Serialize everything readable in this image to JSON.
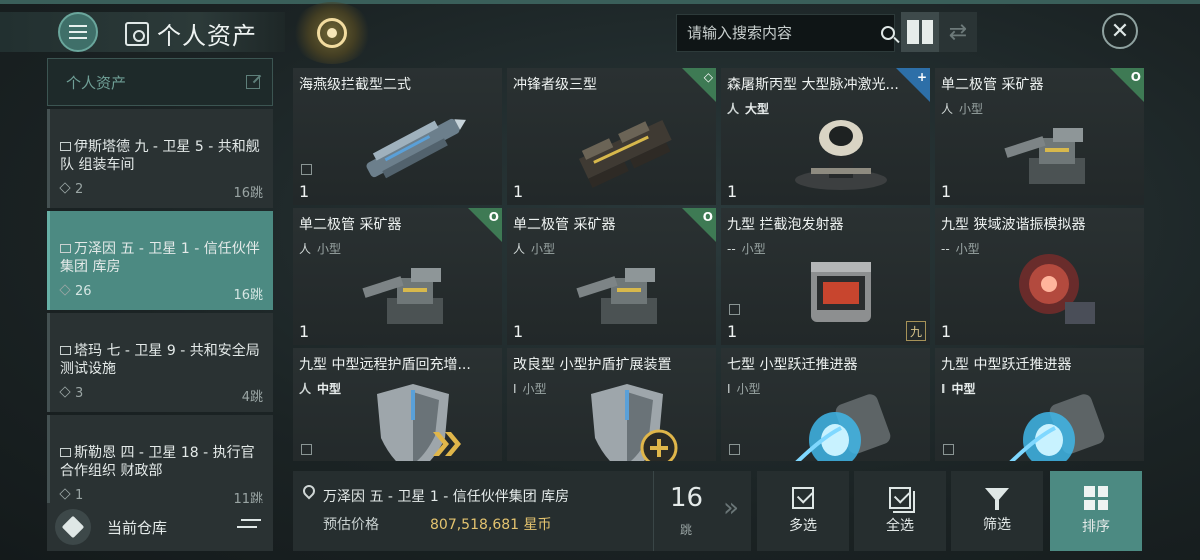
{
  "header": {
    "title": "个人资产",
    "search_placeholder": "请输入搜索内容"
  },
  "sidebar": {
    "heading": "个人资产",
    "locations": [
      {
        "name": "伊斯塔德 九 - 卫星 5 - 共和舰队 组装车间",
        "count": "2",
        "jumps": "16跳",
        "active": false
      },
      {
        "name": "万泽因 五 - 卫星 1 - 信任伙伴集团 库房",
        "count": "26",
        "jumps": "16跳",
        "active": true
      },
      {
        "name": "塔玛 七 - 卫星 9 - 共和安全局 测试设施",
        "count": "3",
        "jumps": "4跳",
        "active": false
      },
      {
        "name": "斯勒恩 四 - 卫星 18 - 执行官合作组织 财政部",
        "count": "1",
        "jumps": "11跳",
        "active": false
      }
    ],
    "current_warehouse": "当前仓库"
  },
  "items": [
    {
      "name": "海燕级拦截型二式",
      "size": "",
      "qty": "1",
      "corner": "",
      "art": "ship"
    },
    {
      "name": "冲锋者级三型",
      "size": "",
      "qty": "1",
      "corner": "◇",
      "art": "ship2"
    },
    {
      "name": "森屠斯丙型 大型脉冲激光...",
      "size": "大型",
      "size_bold": true,
      "qty": "1",
      "corner": "+",
      "corner_color": "blue",
      "art": "laser"
    },
    {
      "name": "单二极管 采矿器",
      "size": "小型",
      "qty": "1",
      "corner": "O",
      "art": "miner"
    },
    {
      "name": "单二极管 采矿器",
      "size": "小型",
      "qty": "1",
      "corner": "O",
      "art": "miner"
    },
    {
      "name": "单二极管 采矿器",
      "size": "小型",
      "qty": "1",
      "corner": "O",
      "art": "miner"
    },
    {
      "name": "九型 拦截泡发射器",
      "size": "小型",
      "size_prefix": "--",
      "qty": "1",
      "corner": "",
      "tier": "九",
      "art": "bubble"
    },
    {
      "name": "九型 狭域波谐振模拟器",
      "size": "小型",
      "size_prefix": "--",
      "qty": "1",
      "corner": "",
      "art": "resonator"
    },
    {
      "name": "九型 中型远程护盾回充增...",
      "size": "中型",
      "size_bold": true,
      "qty": "",
      "corner": "",
      "art": "shield-arrow"
    },
    {
      "name": "改良型 小型护盾扩展装置",
      "size": "小型",
      "size_prefix": "I",
      "qty": "",
      "corner": "",
      "art": "shield-plus"
    },
    {
      "name": "七型 小型跃迁推进器",
      "size": "小型",
      "size_prefix": "I",
      "qty": "",
      "corner": "",
      "art": "thruster"
    },
    {
      "name": "九型 中型跃迁推进器",
      "size": "中型",
      "size_prefix": "I",
      "size_bold": true,
      "qty": "",
      "corner": "",
      "art": "thruster"
    }
  ],
  "footer": {
    "location": "万泽因 五 - 卫星 1 - 信任伙伴集团 库房",
    "price_label": "预估价格",
    "price_value": "807,518,681 星币",
    "jumps": "16",
    "jumps_unit": "跳",
    "actions": [
      "多选",
      "全选",
      "筛选",
      "排序"
    ]
  },
  "colors": {
    "accent": "#4c8a82",
    "price": "#e3c36f",
    "badge_green": "#3e7a54",
    "badge_blue": "#2d6fa8"
  }
}
